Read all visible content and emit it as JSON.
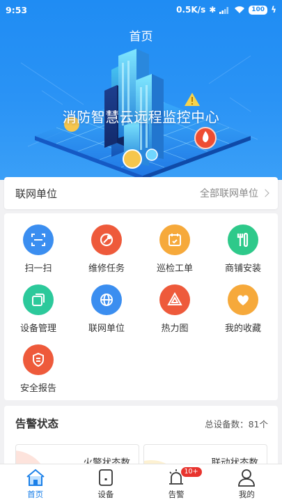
{
  "statusbar": {
    "time": "9:53",
    "speed": "0.5K/s",
    "battery": "100"
  },
  "header": {
    "title": "首页"
  },
  "banner": {
    "text": "消防智慧云远程监控中心"
  },
  "unit_row": {
    "label": "联网单位",
    "link": "全部联网单位"
  },
  "grid": [
    {
      "label": "扫一扫",
      "color": "#3b8ef0",
      "icon": "scan-icon"
    },
    {
      "label": "维修任务",
      "color": "#ee5a3b",
      "icon": "wrench-icon"
    },
    {
      "label": "巡检工单",
      "color": "#f6a93b",
      "icon": "calendar-icon"
    },
    {
      "label": "商铺安装",
      "color": "#2ec98a",
      "icon": "tools-icon"
    },
    {
      "label": "设备管理",
      "color": "#2cc99b",
      "icon": "device-manage-icon"
    },
    {
      "label": "联网单位",
      "color": "#3b8ef0",
      "icon": "globe-icon"
    },
    {
      "label": "热力图",
      "color": "#ee5a3b",
      "icon": "heatmap-icon"
    },
    {
      "label": "我的收藏",
      "color": "#f6a93b",
      "icon": "heart-icon"
    },
    {
      "label": "安全报告",
      "color": "#ee5a3b",
      "icon": "report-icon"
    }
  ],
  "alarm": {
    "title": "告警状态",
    "total": "总设备数：81个",
    "fire_label": "火警状态数",
    "linkage_label": "联动状态数"
  },
  "tabs": [
    {
      "label": "首页",
      "icon": "home-icon",
      "active": true
    },
    {
      "label": "设备",
      "icon": "device-icon",
      "active": false
    },
    {
      "label": "告警",
      "icon": "alarm-bell-icon",
      "active": false,
      "badge": "10+"
    },
    {
      "label": "我的",
      "icon": "user-icon",
      "active": false
    }
  ]
}
